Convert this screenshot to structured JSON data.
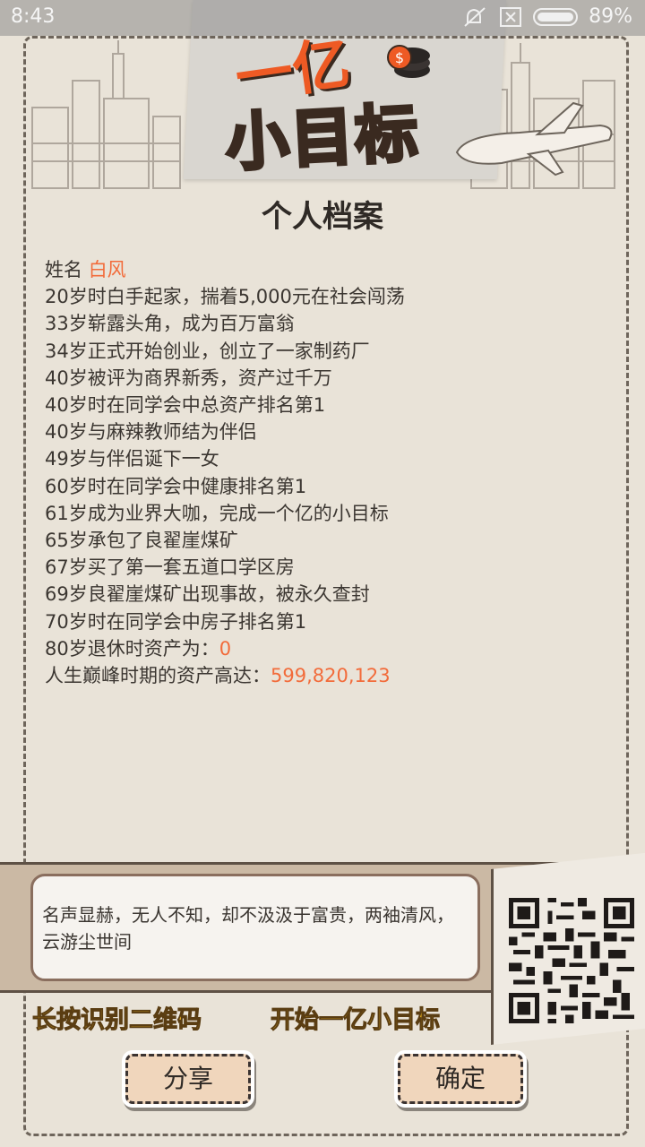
{
  "statusbar": {
    "time": "8:43",
    "battery": "89%",
    "icons": [
      "mute-icon",
      "sim-off-icon",
      "battery-icon"
    ]
  },
  "header": {
    "logo_line1": "一亿",
    "logo_line2": "小目标"
  },
  "page_title": "个人档案",
  "profile": {
    "name_label": "姓名",
    "name_value": "白风",
    "events": [
      "20岁时白手起家，揣着5,000元在社会闯荡",
      "33岁崭露头角，成为百万富翁",
      "34岁正式开始创业，创立了一家制药厂",
      "40岁被评为商界新秀，资产过千万",
      "40岁时在同学会中总资产排名第1",
      "40岁与麻辣教师结为伴侣",
      "49岁与伴侣诞下一女",
      "60岁时在同学会中健康排名第1",
      "61岁成为业界大咖，完成一个亿的小目标",
      "65岁承包了良翟崖煤矿",
      "67岁买了第一套五道口学区房",
      "69岁良翟崖煤矿出现事故，被永久查封",
      "70岁时在同学会中房子排名第1"
    ],
    "retire_label": "80岁退休时资产为：",
    "retire_value": "0",
    "peak_label": "人生巅峰时期的资产高达：",
    "peak_value": "599,820,123"
  },
  "summary_text": "名声显赫，无人不知，却不汲汲于富贵，两袖清风，云游尘世间",
  "cta": {
    "left": "长按识别二维码",
    "right": "开始一亿小目标"
  },
  "buttons": {
    "share": "分享",
    "confirm": "确定"
  },
  "colors": {
    "accent": "#f26b3a",
    "cta_yellow": "#e8b21f",
    "paper": "#e9e3d8"
  }
}
